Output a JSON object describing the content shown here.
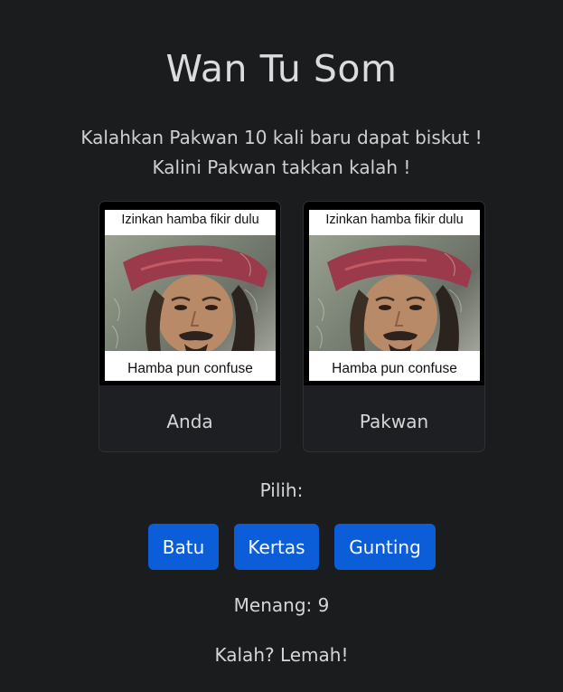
{
  "title": "Wan Tu Som",
  "subtitle_line1": "Kalahkan Pakwan 10 kali baru dapat biskut !",
  "subtitle_line2": "Kalini Pakwan takkan kalah !",
  "player_card": {
    "meme_top_text": "Izinkan hamba fikir dulu",
    "meme_bottom_text": "Hamba pun confuse",
    "label": "Anda"
  },
  "opponent_card": {
    "meme_top_text": "Izinkan hamba fikir dulu",
    "meme_bottom_text": "Hamba pun confuse",
    "label": "Pakwan"
  },
  "choose_label": "Pilih:",
  "buttons": {
    "rock": "Batu",
    "paper": "Kertas",
    "scissors": "Gunting"
  },
  "wins_label": "Menang: 9",
  "lose_message": "Kalah? Lemah!",
  "colors": {
    "background": "#1b1c1e",
    "button": "#0b5ed7",
    "text": "#d6d6d6"
  }
}
